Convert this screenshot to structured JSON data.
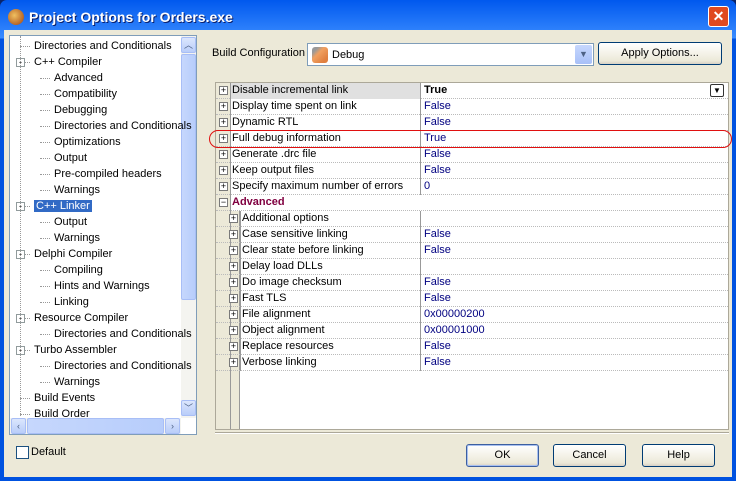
{
  "window": {
    "title": "Project Options for Orders.exe",
    "close_icon": "close-icon"
  },
  "tree": {
    "items": [
      {
        "label": "Directories and Conditionals",
        "level": 0,
        "toggle": ""
      },
      {
        "label": "C++ Compiler",
        "level": 0,
        "toggle": "-"
      },
      {
        "label": "Advanced",
        "level": 1,
        "toggle": ""
      },
      {
        "label": "Compatibility",
        "level": 1,
        "toggle": ""
      },
      {
        "label": "Debugging",
        "level": 1,
        "toggle": ""
      },
      {
        "label": "Directories and Conditionals",
        "level": 1,
        "toggle": ""
      },
      {
        "label": "Optimizations",
        "level": 1,
        "toggle": ""
      },
      {
        "label": "Output",
        "level": 1,
        "toggle": ""
      },
      {
        "label": "Pre-compiled headers",
        "level": 1,
        "toggle": ""
      },
      {
        "label": "Warnings",
        "level": 1,
        "toggle": ""
      },
      {
        "label": "C++ Linker",
        "level": 0,
        "toggle": "-",
        "selected": true
      },
      {
        "label": "Output",
        "level": 1,
        "toggle": ""
      },
      {
        "label": "Warnings",
        "level": 1,
        "toggle": ""
      },
      {
        "label": "Delphi Compiler",
        "level": 0,
        "toggle": "-"
      },
      {
        "label": "Compiling",
        "level": 1,
        "toggle": ""
      },
      {
        "label": "Hints and Warnings",
        "level": 1,
        "toggle": ""
      },
      {
        "label": "Linking",
        "level": 1,
        "toggle": ""
      },
      {
        "label": "Resource Compiler",
        "level": 0,
        "toggle": "-"
      },
      {
        "label": "Directories and Conditionals",
        "level": 1,
        "toggle": ""
      },
      {
        "label": "Turbo Assembler",
        "level": 0,
        "toggle": "-"
      },
      {
        "label": "Directories and Conditionals",
        "level": 1,
        "toggle": ""
      },
      {
        "label": "Warnings",
        "level": 1,
        "toggle": ""
      },
      {
        "label": "Build Events",
        "level": 0,
        "toggle": ""
      },
      {
        "label": "Build Order",
        "level": 0,
        "toggle": ""
      }
    ]
  },
  "build_config": {
    "label": "Build Configuration",
    "value": "Debug",
    "apply_label": "Apply Options..."
  },
  "grid": {
    "rows": [
      {
        "name": "Disable incremental link",
        "value": "True",
        "type": "first"
      },
      {
        "name": "Display time spent on link",
        "value": "False"
      },
      {
        "name": "Dynamic RTL",
        "value": "False"
      },
      {
        "name": "Full debug information",
        "value": "True",
        "highlighted": true
      },
      {
        "name": "Generate .drc file",
        "value": "False"
      },
      {
        "name": "Keep output files",
        "value": "False"
      },
      {
        "name": "Specify maximum number of errors",
        "value": "0"
      },
      {
        "name": "Advanced",
        "value": "",
        "type": "cat"
      },
      {
        "name": "Additional options",
        "value": "",
        "type": "child"
      },
      {
        "name": "Case sensitive linking",
        "value": "False",
        "type": "child"
      },
      {
        "name": "Clear state before linking",
        "value": "False",
        "type": "child"
      },
      {
        "name": "Delay load DLLs",
        "value": "",
        "type": "child"
      },
      {
        "name": "Do image checksum",
        "value": "False",
        "type": "child"
      },
      {
        "name": "Fast TLS",
        "value": "False",
        "type": "child"
      },
      {
        "name": "File alignment",
        "value": "0x00000200",
        "type": "child"
      },
      {
        "name": "Object alignment",
        "value": "0x00001000",
        "type": "child"
      },
      {
        "name": "Replace resources",
        "value": "False",
        "type": "child"
      },
      {
        "name": "Verbose linking",
        "value": "False",
        "type": "child"
      }
    ]
  },
  "footer": {
    "default_label": "Default",
    "ok": "OK",
    "cancel": "Cancel",
    "help": "Help"
  },
  "colors": {
    "highlight_ellipse": "#e01010",
    "selection": "#316ac5",
    "category": "#800040",
    "value": "#000080"
  }
}
